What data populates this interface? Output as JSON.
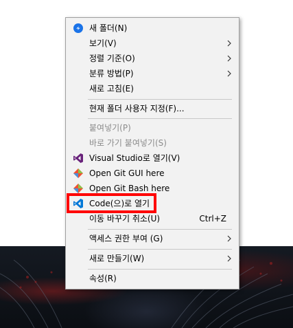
{
  "menu": {
    "items": [
      {
        "label": "새 폴더(N)",
        "icon": "new-folder-icon"
      },
      {
        "label": "보기(V)"
      },
      {
        "label": "정렬 기준(O)"
      },
      {
        "label": "분류 방법(P)"
      },
      {
        "label": "새로 고침(E)"
      },
      {
        "label": "현재 폴더 사용자 지정(F)..."
      },
      {
        "label": "붙여넣기(P)"
      },
      {
        "label": "바로 가기 붙여넣기(S)"
      },
      {
        "label": "Visual Studio로 열기(V)",
        "icon": "visual-studio-icon"
      },
      {
        "label": "Open Git GUI here",
        "icon": "git-icon"
      },
      {
        "label": "Open Git Bash here",
        "icon": "git-icon"
      },
      {
        "label": "Code(으)로 열기",
        "icon": "vscode-icon"
      },
      {
        "label": "이동 바꾸기 취소(U)",
        "shortcut": "Ctrl+Z"
      },
      {
        "label": "액세스 권한 부여 (G)"
      },
      {
        "label": "새로 만들기(W)"
      },
      {
        "label": "속성(R)"
      }
    ]
  },
  "colors": {
    "menu_bg": "#f2f2f2",
    "highlight": "#ff0000",
    "disabled_text": "#8b8b8b",
    "vs_purple": "#68217a",
    "vscode_blue": "#0078d7",
    "git_orange": "#f05032"
  }
}
